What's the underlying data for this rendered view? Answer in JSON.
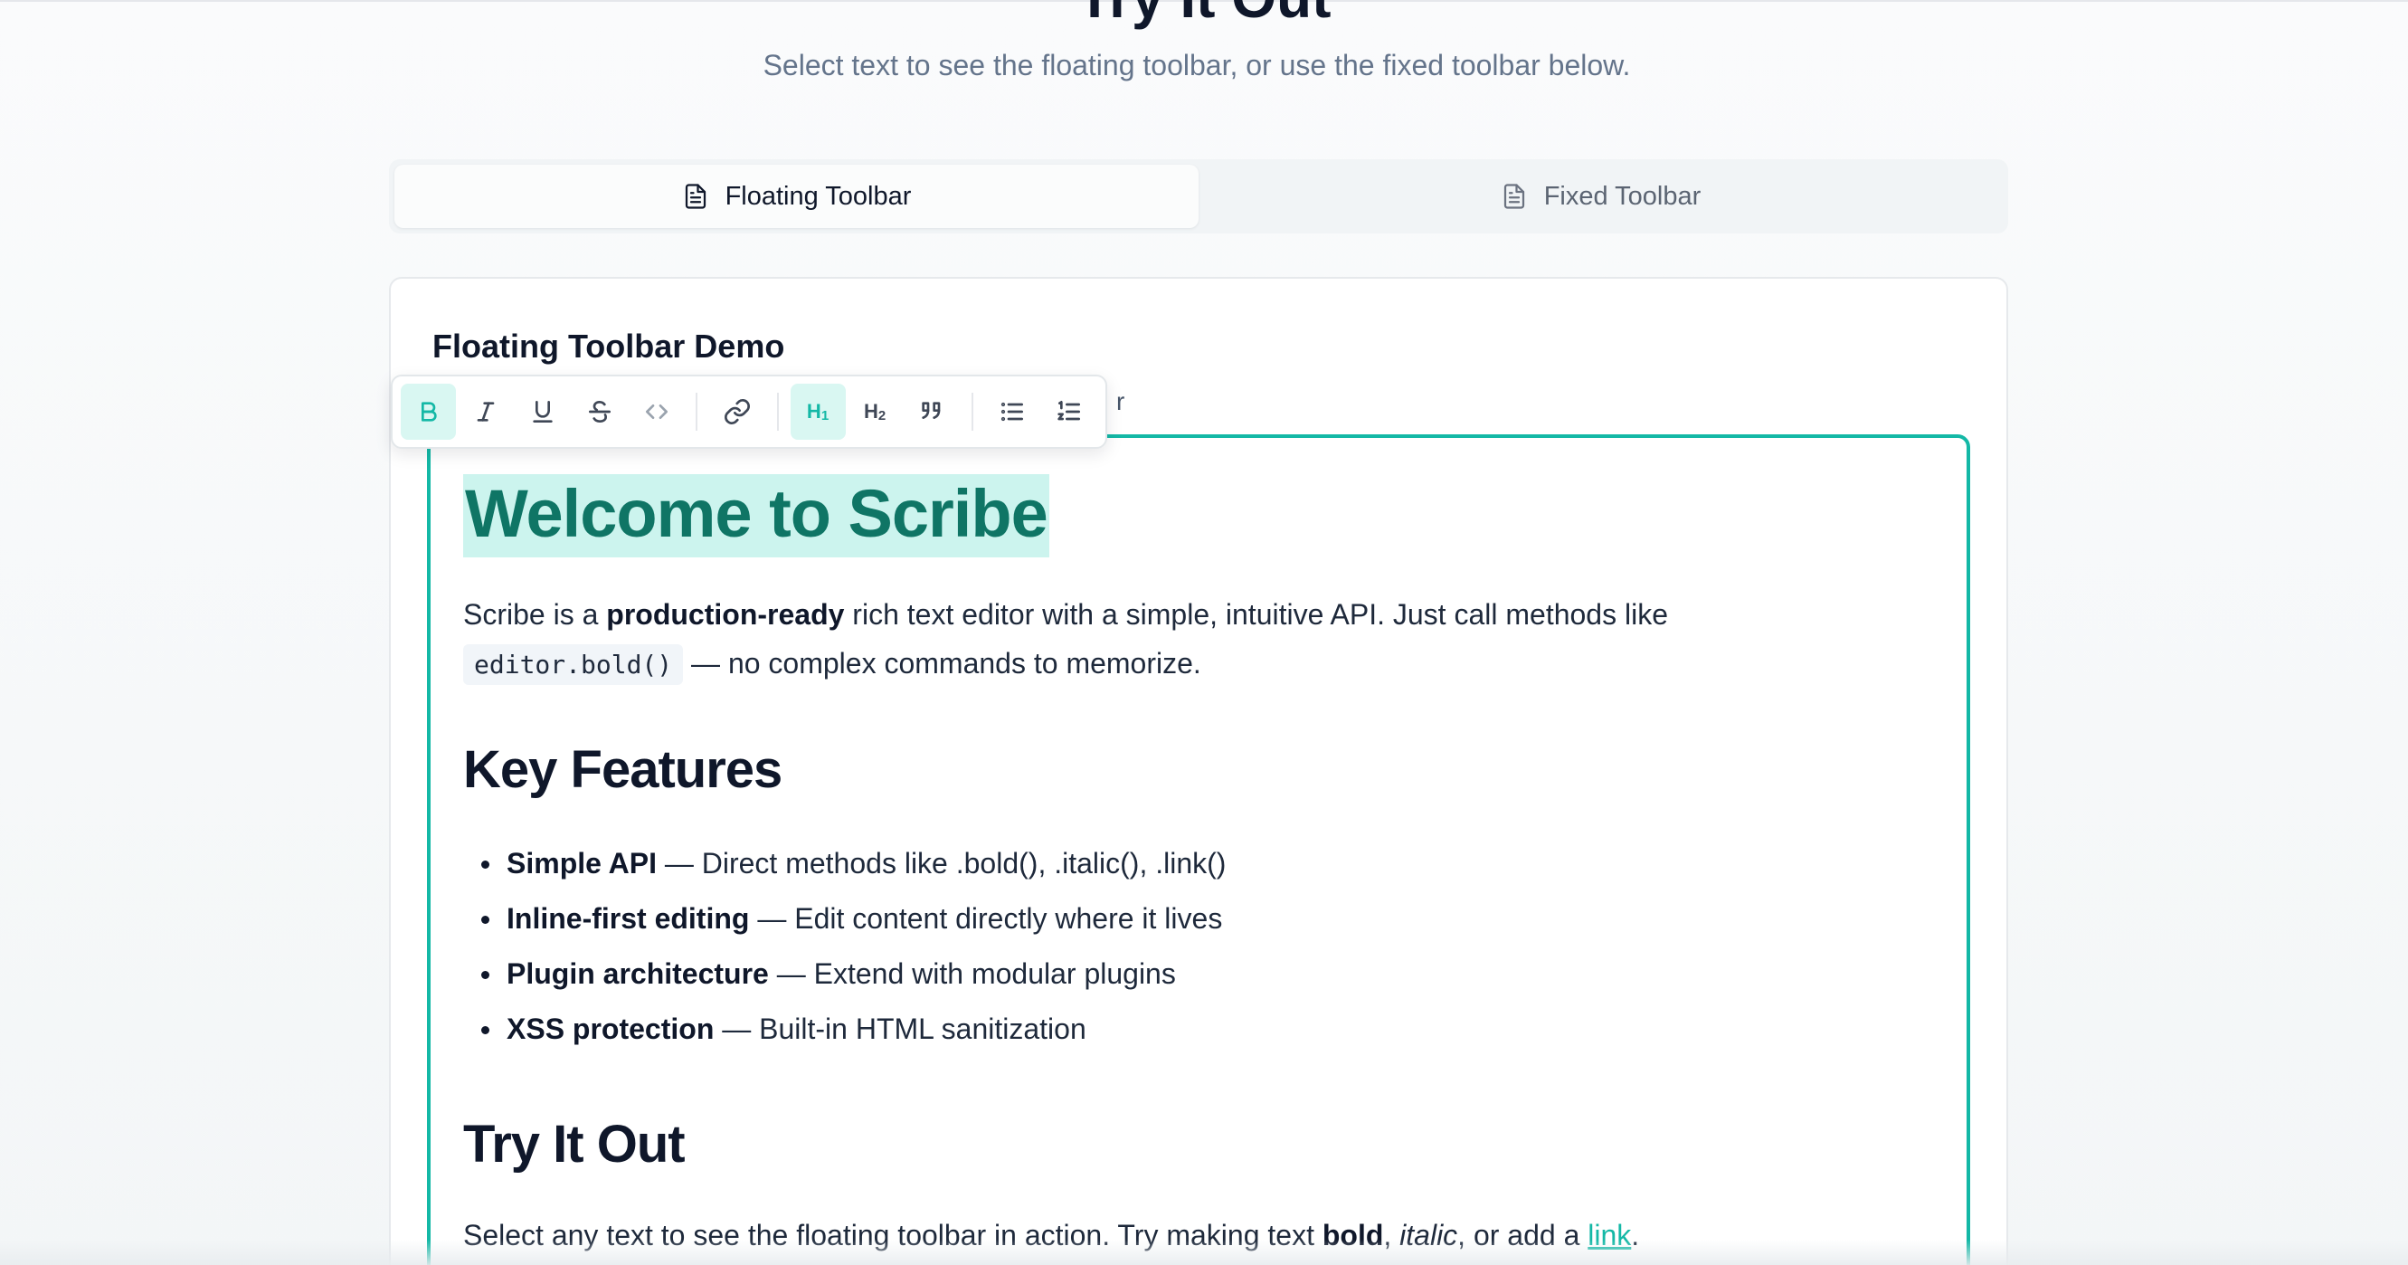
{
  "page": {
    "section_title": "Try It Out",
    "section_subtitle": "Select text to see the floating toolbar, or use the fixed toolbar below."
  },
  "tabs": [
    {
      "label": "Floating Toolbar",
      "icon": "document-icon",
      "active": true
    },
    {
      "label": "Fixed Toolbar",
      "icon": "document-icon",
      "active": false
    }
  ],
  "demo": {
    "title": "Floating Toolbar Demo",
    "description_tail": "r"
  },
  "toolbar": {
    "buttons": [
      {
        "name": "bold-button",
        "icon": "bold-icon",
        "active": true
      },
      {
        "name": "italic-button",
        "icon": "italic-icon"
      },
      {
        "name": "underline-button",
        "icon": "underline-icon"
      },
      {
        "name": "strikethrough-button",
        "icon": "strikethrough-icon"
      },
      {
        "name": "code-button",
        "icon": "code-icon"
      },
      {
        "name": "link-button",
        "icon": "link-icon"
      },
      {
        "name": "heading1-button",
        "icon": "heading1-icon",
        "active": true
      },
      {
        "name": "heading2-button",
        "icon": "heading2-icon"
      },
      {
        "name": "blockquote-button",
        "icon": "quote-icon"
      },
      {
        "name": "bullet-list-button",
        "icon": "bullet-list-icon"
      },
      {
        "name": "ordered-list-button",
        "icon": "ordered-list-icon"
      }
    ],
    "h1_label": "H",
    "h1_sub": "1",
    "h2_label": "H",
    "h2_sub": "2"
  },
  "editor": {
    "heading": "Welcome to Scribe",
    "intro": {
      "pre": "Scribe is a ",
      "bold": "production-ready",
      "mid": " rich text editor with a simple, intuitive API. Just call methods like",
      "code": "editor.bold()",
      "post": " — no complex commands to memorize."
    },
    "features_heading": "Key Features",
    "features": [
      {
        "bold": "Simple API",
        "text": " — Direct methods like .bold(), .italic(), .link()"
      },
      {
        "bold": "Inline-first editing",
        "text": " — Edit content directly where it lives"
      },
      {
        "bold": "Plugin architecture",
        "text": " — Extend with modular plugins"
      },
      {
        "bold": "XSS protection",
        "text": " — Built-in HTML sanitization"
      }
    ],
    "try_heading": "Try It Out",
    "try": {
      "pre": "Select any text to see the floating toolbar in action. Try making text ",
      "bold": "bold",
      "comma1": ", ",
      "italic": "italic",
      "mid": ", or add a ",
      "link": "link",
      "end": "."
    }
  },
  "colors": {
    "accent": "#14b8a6",
    "heading_highlight": "#ccf4ee",
    "heading_text": "#0f7565"
  }
}
